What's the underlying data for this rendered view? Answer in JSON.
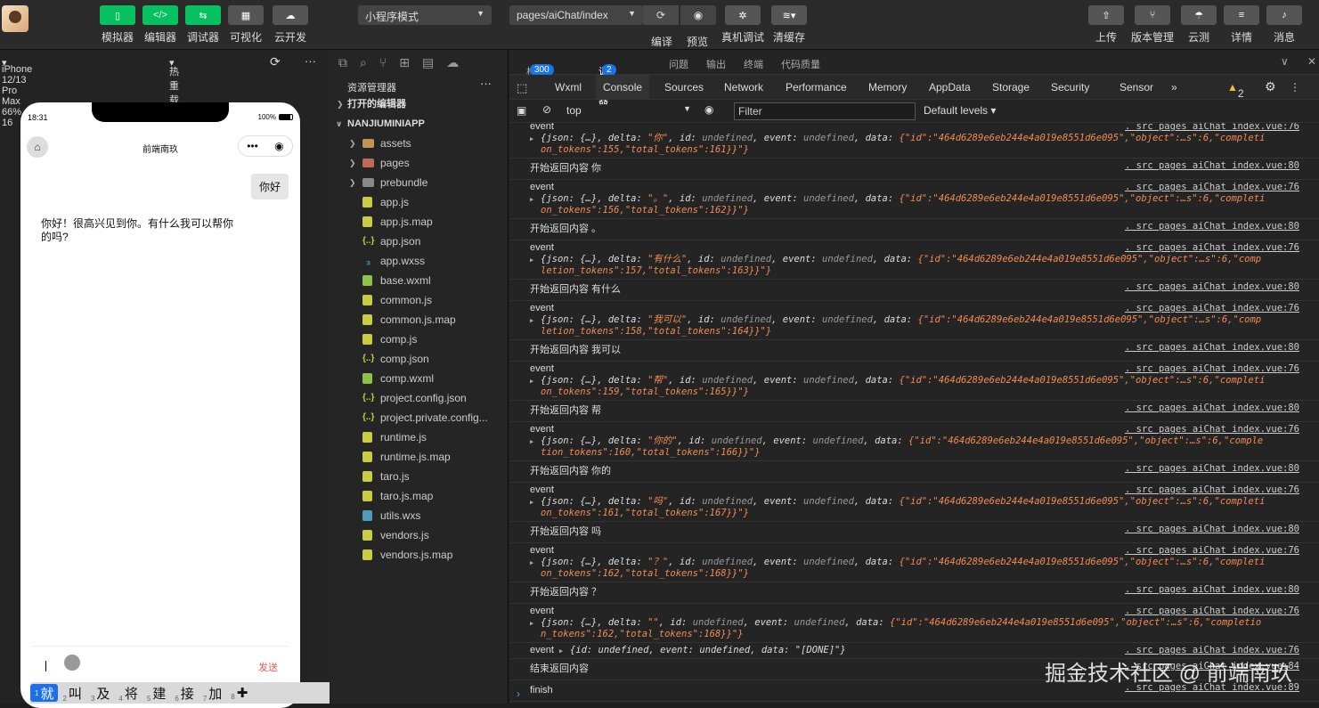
{
  "toolbar": {
    "left_buttons": [
      "模拟器",
      "编辑器",
      "调试器",
      "可视化",
      "云开发"
    ],
    "mode_select": "小程序模式",
    "page_select": "pages/aiChat/index",
    "mid_buttons": [
      "编译",
      "预览",
      "真机调试",
      "清缓存"
    ],
    "right_buttons": [
      "上传",
      "版本管理",
      "云测",
      "详情",
      "消息"
    ]
  },
  "simulator": {
    "device": "iPhone 12/13 Pro Max 66% 16",
    "hot_reload": "热重载 关",
    "time": "18:31",
    "battery": "100%",
    "nav_title": "前端南玖",
    "user_message": "你好",
    "ai_message": "你好！很高兴见到你。有什么我可以帮你的吗?",
    "send_label": "发送",
    "candidates": [
      {
        "n": "1",
        "w": "就"
      },
      {
        "n": "2",
        "w": "叫"
      },
      {
        "n": "3",
        "w": "及"
      },
      {
        "n": "4",
        "w": "将"
      },
      {
        "n": "5",
        "w": "建"
      },
      {
        "n": "6",
        "w": "接"
      },
      {
        "n": "7",
        "w": "加"
      },
      {
        "n": "8",
        "w": "✚"
      }
    ]
  },
  "explorer": {
    "title": "资源管理器",
    "open_editors": "打开的编辑器",
    "project": "NANJIUMINIAPP",
    "files": [
      {
        "name": "assets",
        "type": "folder"
      },
      {
        "name": "pages",
        "type": "folder-red"
      },
      {
        "name": "prebundle",
        "type": "folder-grey"
      },
      {
        "name": "app.js",
        "type": "js"
      },
      {
        "name": "app.js.map",
        "type": "js"
      },
      {
        "name": "app.json",
        "type": "json"
      },
      {
        "name": "app.wxss",
        "type": "css"
      },
      {
        "name": "base.wxml",
        "type": "wxml"
      },
      {
        "name": "common.js",
        "type": "js"
      },
      {
        "name": "common.js.map",
        "type": "js"
      },
      {
        "name": "comp.js",
        "type": "js"
      },
      {
        "name": "comp.json",
        "type": "json"
      },
      {
        "name": "comp.wxml",
        "type": "wxml"
      },
      {
        "name": "project.config.json",
        "type": "json"
      },
      {
        "name": "project.private.config...",
        "type": "json"
      },
      {
        "name": "runtime.js",
        "type": "js"
      },
      {
        "name": "runtime.js.map",
        "type": "js"
      },
      {
        "name": "taro.js",
        "type": "js"
      },
      {
        "name": "taro.js.map",
        "type": "js"
      },
      {
        "name": "utils.wxs",
        "type": "wxs"
      },
      {
        "name": "vendors.js",
        "type": "js"
      },
      {
        "name": "vendors.js.map",
        "type": "js"
      }
    ]
  },
  "devtools": {
    "top_tabs": [
      {
        "label": "构建",
        "badge": "300"
      },
      {
        "label": "调试器",
        "badge": "2"
      },
      {
        "label": "问题"
      },
      {
        "label": "输出"
      },
      {
        "label": "终端"
      },
      {
        "label": "代码质量"
      }
    ],
    "panel_tabs": [
      "Wxml",
      "Console",
      "Sources",
      "Network",
      "Performance",
      "Memory",
      "AppData",
      "Storage",
      "Security",
      "Sensor"
    ],
    "warning_count": "2",
    "context": "top",
    "filter_placeholder": "Filter",
    "levels": "Default levels"
  },
  "console_logs": [
    {
      "kind": "event",
      "delta": "\"你\"",
      "prefix": "{\"id\":\"464d6289e6eb244e4a019e8551d6e095\",\"object\":…s\":6,\"completi",
      "tail": "on_tokens\":155,\"total_tokens\":161}}\"}",
      "src": ". src pages aiChat index.vue:76",
      "partial": true
    },
    {
      "kind": "text",
      "text": "开始返回内容 你",
      "src": ". src pages aiChat index.vue:80"
    },
    {
      "kind": "event",
      "delta": "\"。\"",
      "prefix": "{\"id\":\"464d6289e6eb244e4a019e8551d6e095\",\"object\":…s\":6,\"completi",
      "tail": "on_tokens\":156,\"total_tokens\":162}}\"}",
      "src": ". src pages aiChat index.vue:76"
    },
    {
      "kind": "text",
      "text": "开始返回内容 。",
      "src": ". src pages aiChat index.vue:80"
    },
    {
      "kind": "event",
      "delta": "\"有什么\"",
      "prefix": "{\"id\":\"464d6289e6eb244e4a019e8551d6e095\",\"object\":…s\":6,\"comp",
      "tail": "letion_tokens\":157,\"total_tokens\":163}}\"}",
      "src": ". src pages aiChat index.vue:76"
    },
    {
      "kind": "text",
      "text": "开始返回内容 有什么",
      "src": ". src pages aiChat index.vue:80"
    },
    {
      "kind": "event",
      "delta": "\"我可以\"",
      "prefix": "{\"id\":\"464d6289e6eb244e4a019e8551d6e095\",\"object\":…s\":6,\"comp",
      "tail": "letion_tokens\":158,\"total_tokens\":164}}\"}",
      "src": ". src pages aiChat index.vue:76"
    },
    {
      "kind": "text",
      "text": "开始返回内容 我可以",
      "src": ". src pages aiChat index.vue:80"
    },
    {
      "kind": "event",
      "delta": "\"帮\"",
      "prefix": "{\"id\":\"464d6289e6eb244e4a019e8551d6e095\",\"object\":…s\":6,\"completi",
      "tail": "on_tokens\":159,\"total_tokens\":165}}\"}",
      "src": ". src pages aiChat index.vue:76"
    },
    {
      "kind": "text",
      "text": "开始返回内容 帮",
      "src": ". src pages aiChat index.vue:80"
    },
    {
      "kind": "event",
      "delta": "\"你的\"",
      "prefix": "{\"id\":\"464d6289e6eb244e4a019e8551d6e095\",\"object\":…s\":6,\"comple",
      "tail": "tion_tokens\":160,\"total_tokens\":166}}\"}",
      "src": ". src pages aiChat index.vue:76"
    },
    {
      "kind": "text",
      "text": "开始返回内容 你的",
      "src": ". src pages aiChat index.vue:80"
    },
    {
      "kind": "event",
      "delta": "\"吗\"",
      "prefix": "{\"id\":\"464d6289e6eb244e4a019e8551d6e095\",\"object\":…s\":6,\"completi",
      "tail": "on_tokens\":161,\"total_tokens\":167}}\"}",
      "src": ". src pages aiChat index.vue:76"
    },
    {
      "kind": "text",
      "text": "开始返回内容 吗",
      "src": ". src pages aiChat index.vue:80"
    },
    {
      "kind": "event",
      "delta": "\"？\"",
      "prefix": "{\"id\":\"464d6289e6eb244e4a019e8551d6e095\",\"object\":…s\":6,\"completi",
      "tail": "on_tokens\":162,\"total_tokens\":168}}\"}",
      "src": ". src pages aiChat index.vue:76"
    },
    {
      "kind": "text",
      "text": "开始返回内容 ？",
      "src": ". src pages aiChat index.vue:80"
    },
    {
      "kind": "event",
      "delta": "\"\"",
      "prefix": "{\"id\":\"464d6289e6eb244e4a019e8551d6e095\",\"object\":…s\":6,\"completio",
      "tail": "n_tokens\":162,\"total_tokens\":168}}\"}",
      "src": ". src pages aiChat index.vue:76"
    },
    {
      "kind": "done",
      "text": "event",
      "obj": "{id: undefined, event: undefined, data: \"[DONE]\"}",
      "src": ". src pages aiChat index.vue:76"
    },
    {
      "kind": "text",
      "text": "结束返回内容",
      "src": ". src pages aiChat index.vue:84"
    },
    {
      "kind": "text",
      "text": "finish",
      "src": ". src pages aiChat index.vue:89"
    },
    {
      "kind": "text",
      "text": "你好！很高兴见到你。有什么我可以帮你的吗?",
      "src": ""
    }
  ],
  "watermark": "掘金技术社区 @ 前端南玖"
}
